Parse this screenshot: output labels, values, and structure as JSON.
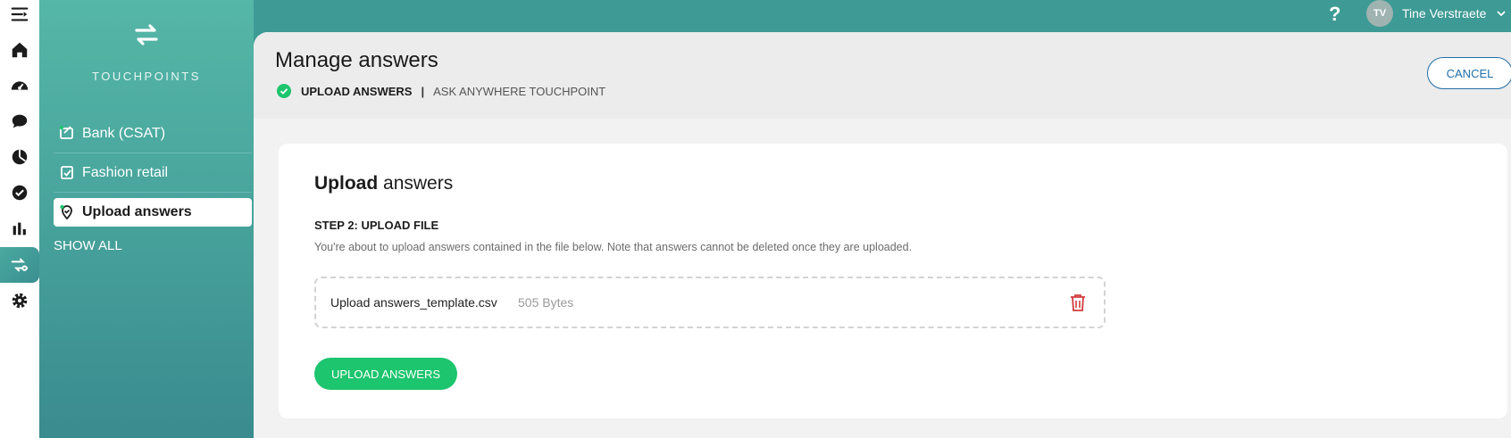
{
  "topbar": {
    "help": "?",
    "avatar_initials": "TV",
    "user_name": "Tine Verstraete"
  },
  "rail": {
    "icons": [
      "menu-icon",
      "home-icon",
      "dashboard-icon",
      "chat-icon",
      "pie-chart-icon",
      "check-circle-icon",
      "bar-chart-icon",
      "touchpoints-icon",
      "settings-icon"
    ],
    "active": "touchpoints-icon"
  },
  "panel": {
    "title": "TOUCHPOINTS",
    "items": [
      {
        "label": "Bank (CSAT)",
        "icon": "touchpoint-edit-icon"
      },
      {
        "label": "Fashion retail",
        "icon": "touchpoint-check-icon"
      },
      {
        "label": "Upload answers",
        "icon": "touchpoint-location-icon",
        "selected": true
      }
    ],
    "show_all": "SHOW ALL"
  },
  "header": {
    "title": "Manage answers",
    "breadcrumb_step": "UPLOAD ANSWERS",
    "breadcrumb_sep": "|",
    "breadcrumb_current": "ASK ANYWHERE TOUCHPOINT",
    "cancel_label": "CANCEL"
  },
  "card": {
    "title_bold": "Upload",
    "title_rest": "answers",
    "step_label": "STEP 2: UPLOAD FILE",
    "step_desc": "You're about to upload answers contained in the file below. Note that answers cannot be deleted once they are uploaded.",
    "file_name": "Upload answers_template.csv",
    "file_size": "505 Bytes",
    "upload_label": "UPLOAD ANSWERS"
  },
  "colors": {
    "teal": "#3d9a94",
    "accent_green": "#1cc56e",
    "cancel_blue": "#1f6fa8",
    "trash_red": "#d23b3b"
  }
}
